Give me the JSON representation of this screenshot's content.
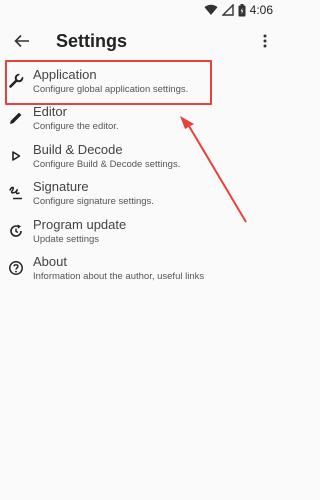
{
  "status_bar": {
    "time": "4:06"
  },
  "header": {
    "title": "Settings"
  },
  "items": [
    {
      "label": "Application",
      "sub": "Configure global application settings.",
      "icon": "wrench-icon"
    },
    {
      "label": "Editor",
      "sub": "Configure the editor.",
      "icon": "pencil-icon"
    },
    {
      "label": "Build & Decode",
      "sub": "Configure Build & Decode settings.",
      "icon": "play-icon"
    },
    {
      "label": "Signature",
      "sub": "Configure signature settings.",
      "icon": "signature-icon"
    },
    {
      "label": "Program update",
      "sub": "Update settings",
      "icon": "update-icon"
    },
    {
      "label": "About",
      "sub": "Information about the author, useful links",
      "icon": "help-icon"
    }
  ],
  "annotation": {
    "color": "#e8413d"
  }
}
